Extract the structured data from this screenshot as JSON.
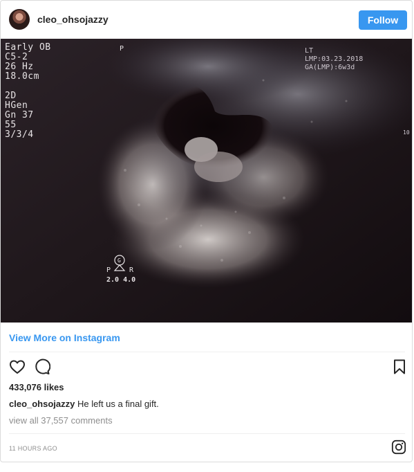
{
  "header": {
    "username": "cleo_ohsojazzy",
    "follow_label": "Follow",
    "avatar_icon": "profile-avatar"
  },
  "post_image": {
    "overlay_left": [
      "Early OB",
      "C5-2",
      "26 Hz",
      "18.0cm",
      "",
      "2D",
      " HGen",
      " Gn 37",
      " 55",
      " 3/3/4"
    ],
    "overlay_p": "P",
    "overlay_right": [
      "LT",
      "LMP:03.23.2018",
      "GA(LMP):6w3d"
    ],
    "overlay_edge": "10",
    "probe_letter": "G",
    "probe_p": "P",
    "probe_r": "R",
    "probe_values": "2.0 4.0"
  },
  "links": {
    "view_more": "View More on Instagram"
  },
  "actions": {
    "like_icon": "heart-icon",
    "comment_icon": "comment-icon",
    "save_icon": "bookmark-icon"
  },
  "stats": {
    "likes": "433,076 likes"
  },
  "caption": {
    "username": "cleo_ohsojazzy",
    "text": "He left us a final gift."
  },
  "comments": {
    "view_all": "view all 37,557 comments"
  },
  "footer": {
    "timestamp": "11 HOURS AGO",
    "logo_icon": "instagram-icon"
  },
  "colors": {
    "accent": "#3897f0",
    "text": "#262626",
    "muted": "#8e8e8e",
    "border": "#dbdbdb"
  }
}
